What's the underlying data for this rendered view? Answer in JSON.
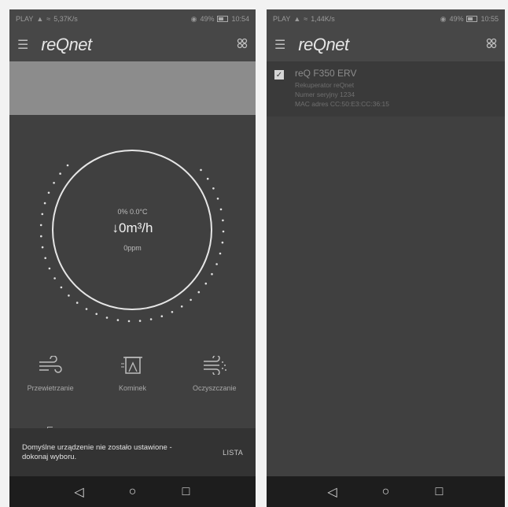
{
  "left": {
    "status": {
      "carrier": "PLAY",
      "speed": "5,37K/s",
      "battery": "49%",
      "time": "10:54"
    },
    "app": {
      "logo": "reQnet"
    },
    "gauge": {
      "top": "0% 0.0°C",
      "main": "↓0m³/h",
      "bottom": "0ppm"
    },
    "modes": [
      {
        "icon": "wind-icon",
        "label": "Przewietrzanie"
      },
      {
        "icon": "fireplace-icon",
        "label": "Kominek"
      },
      {
        "icon": "purify-icon",
        "label": "Oczyszczanie"
      }
    ],
    "snackbar": {
      "message": "Domyślne urządzenie nie zostało ustawione - dokonaj wyboru.",
      "action": "LISTA"
    }
  },
  "right": {
    "status": {
      "carrier": "PLAY",
      "speed": "1,44K/s",
      "battery": "49%",
      "time": "10:55"
    },
    "app": {
      "logo": "reQnet"
    },
    "device": {
      "name": "reQ F350 ERV",
      "type": "Rekuperator reQnet",
      "serial": "Numer seryjny 1234",
      "mac": "MAC adres CC:50:E3:CC:36:15",
      "checked": true
    }
  },
  "colors": {
    "background": "#404040",
    "banner": "#8c8c8c",
    "snackbar": "#333333",
    "navbar": "#1d1d1d"
  }
}
